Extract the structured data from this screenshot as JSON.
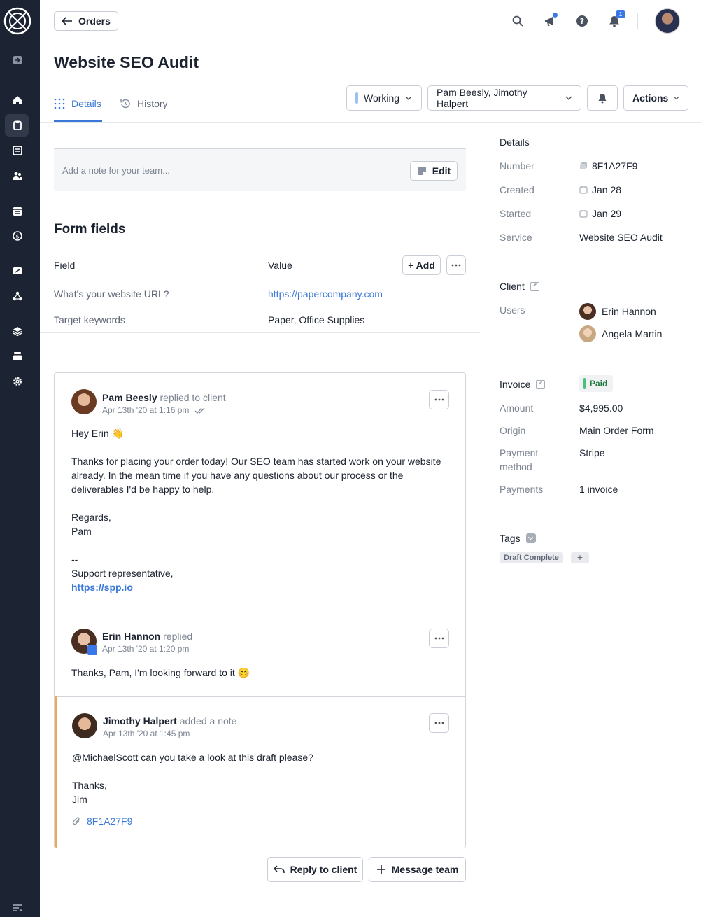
{
  "topbar": {
    "back_label": "Orders",
    "notification_count": "1"
  },
  "page": {
    "title": "Website SEO Audit"
  },
  "tabs": [
    {
      "label": "Details"
    },
    {
      "label": "History"
    }
  ],
  "header_controls": {
    "status": "Working",
    "assignees": "Pam Beesly, Jimothy Halpert",
    "actions": "Actions"
  },
  "note": {
    "placeholder": "Add a note for your team...",
    "edit_label": "Edit"
  },
  "form_fields": {
    "title": "Form fields",
    "col_field": "Field",
    "col_value": "Value",
    "add_label": "+ Add",
    "rows": [
      {
        "field": "What's your website URL?",
        "value": "https://papercompany.com"
      },
      {
        "field": "Target keywords",
        "value": "Paper, Office Supplies"
      }
    ]
  },
  "messages": [
    {
      "author": "Pam Beesly",
      "action": "replied to client",
      "time": "Apr 13th '20 at 1:16 pm",
      "lines": [
        "Hey Erin 👋",
        "",
        "Thanks for placing your order today! Our SEO team has started work on your website already. In the mean time if you have any questions about our process or the deliverables I'd be happy to help.",
        "",
        "Regards,",
        "Pam",
        "",
        "--",
        "Support representative,"
      ],
      "link": "https://spp.io"
    },
    {
      "author": "Erin Hannon",
      "action": "replied",
      "time": "Apr 13th '20 at 1:20 pm",
      "lines": [
        "Thanks, Pam, I'm looking forward to it 😊"
      ]
    },
    {
      "author": "Jimothy Halpert",
      "action": "added a note",
      "time": "Apr 13th '20 at 1:45 pm",
      "lines": [
        "@MichaelScott can you take a look at this draft please?",
        "",
        "Thanks,",
        "Jim"
      ],
      "attachment": "8F1A27F9"
    }
  ],
  "bottom_actions": {
    "reply": "Reply to client",
    "message_team": "Message team"
  },
  "details": {
    "heading": "Details",
    "number_label": "Number",
    "number": "8F1A27F9",
    "created_label": "Created",
    "created": "Jan 28",
    "started_label": "Started",
    "started": "Jan 29",
    "service_label": "Service",
    "service": "Website SEO Audit"
  },
  "client": {
    "heading": "Client",
    "users_label": "Users",
    "users": [
      "Erin Hannon",
      "Angela Martin"
    ]
  },
  "invoice": {
    "heading": "Invoice",
    "status": "Paid",
    "amount_label": "Amount",
    "amount": "$4,995.00",
    "origin_label": "Origin",
    "origin": "Main Order Form",
    "payment_method_label_1": "Payment",
    "payment_method_label_2": "method",
    "payment_method": "Stripe",
    "payments_label": "Payments",
    "payments": "1 invoice"
  },
  "tags": {
    "heading": "Tags",
    "items": [
      "Draft Complete"
    ]
  },
  "colors": {
    "sidebar": "#1c2333",
    "accent": "#3a78d8",
    "note_accent": "#f0a55a",
    "paid": "#4bc07a"
  }
}
